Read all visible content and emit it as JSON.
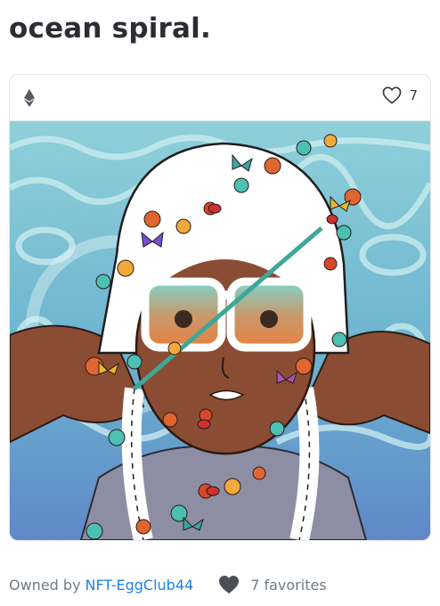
{
  "item": {
    "title": "ocean spiral."
  },
  "card": {
    "chain_icon": "ethereum-icon",
    "favorite_icon": "heart-outline-icon",
    "favorite_count": "7",
    "artwork_alt": "Illustrated character with white hair, sunglasses, and flower-and-butterfly garland over a blue water background"
  },
  "footer": {
    "owned_by_label": "Owned by",
    "owner_name": "NFT-EggClub44",
    "favorites_icon": "heart-filled-icon",
    "favorites_text": "7 favorites"
  },
  "colors": {
    "title": "#2b2d33",
    "link": "#2081e2",
    "muted_text": "#707a83",
    "border": "#e5e8eb",
    "icon_dark": "#4a4f57"
  }
}
